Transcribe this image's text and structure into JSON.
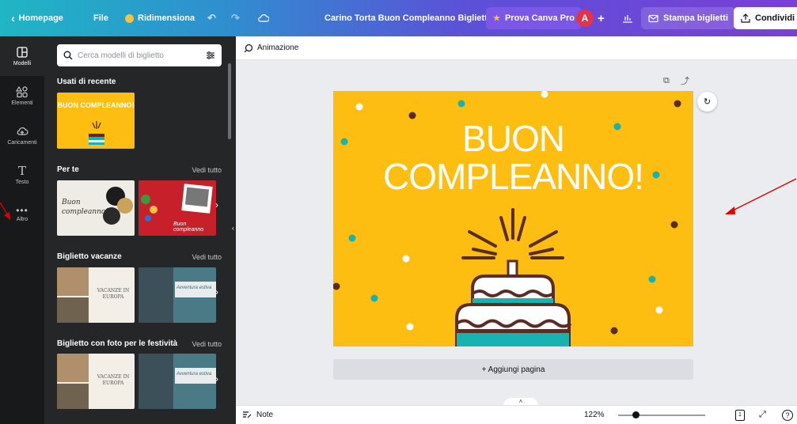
{
  "topbar": {
    "home_label": "Homepage",
    "file_label": "File",
    "resize_label": "Ridimensiona",
    "doc_title": "Carino Torta Buon Compleanno Biglietto",
    "pro_label": "Prova Canva Pro",
    "avatar_letter": "A",
    "print_label": "Stampa biglietti",
    "share_label": "Condividi"
  },
  "nav": {
    "items": [
      {
        "label": "Modelli",
        "icon": "template-icon"
      },
      {
        "label": "Elementi",
        "icon": "shapes-icon"
      },
      {
        "label": "Caricamenti",
        "icon": "cloud-upload-icon"
      },
      {
        "label": "Testo",
        "icon": "text-icon"
      },
      {
        "label": "Altro",
        "icon": "more-icon"
      }
    ]
  },
  "panel": {
    "search_placeholder": "Cerca modelli di biglietto",
    "recent_title": "Usati di recente",
    "recent_thumb_text": "BUON COMPLEANNO!",
    "foryou_title": "Per te",
    "foryou_link": "Vedi tutto",
    "foryou_thumb1_text": "Buon compleanno!",
    "foryou_thumb2_text": "Buon compleanno",
    "holiday_title": "Biglietto vacanze",
    "holiday_link": "Vedi tutto",
    "holiday_thumb1_text": "VACANZE IN EUROPA",
    "holiday_thumb2_text": "Avventura estiva",
    "festive_title": "Biglietto con foto per le festività",
    "festive_link": "Vedi tutto",
    "festive_thumb1_text": "VACANZE IN EUROPA",
    "festive_thumb2_text": "Avventura estiva"
  },
  "subbar": {
    "animation_label": "Animazione"
  },
  "design": {
    "line1": "BUON",
    "line2": "COMPLEANNO!"
  },
  "add_page_label": "+ Aggiungi pagina",
  "bottombar": {
    "notes_label": "Note",
    "zoom": "122%",
    "page_count": "1",
    "zoom_fraction": 0.2
  },
  "colors": {
    "canvas_bg": "#fdbd11",
    "cake_teal": "#16b3b0",
    "dark_brown": "#5a2d24",
    "panel_bg": "#252627",
    "annotation_red": "#e00000"
  }
}
